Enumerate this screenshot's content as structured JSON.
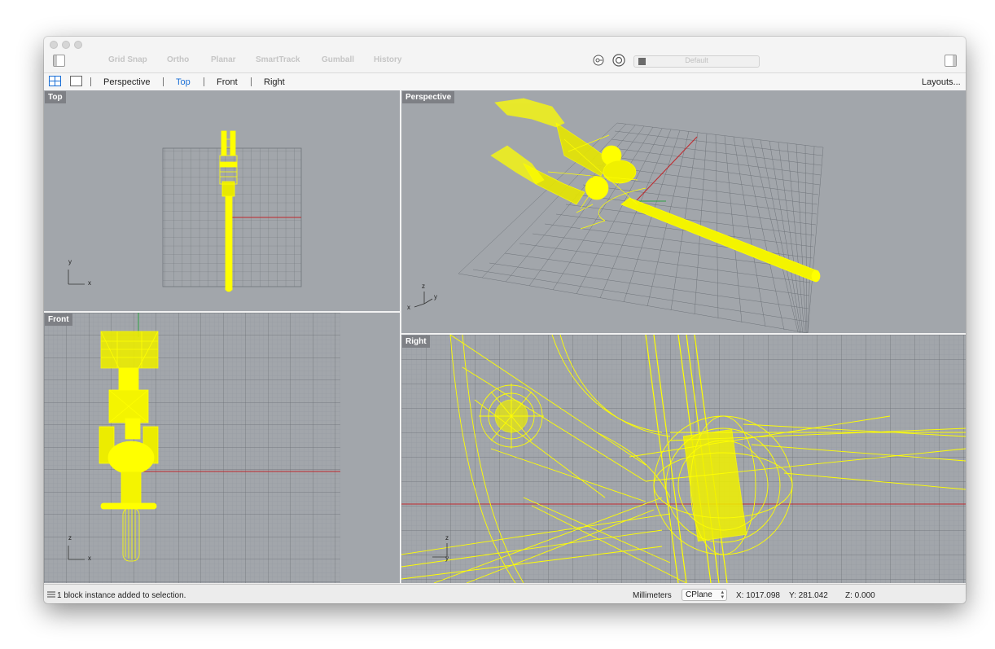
{
  "toolbar": {
    "buttons": [
      "Grid Snap",
      "Ortho",
      "Planar",
      "SmartTrack",
      "Gumball",
      "History"
    ],
    "layer_name": "Default"
  },
  "tabs": {
    "items": [
      "Perspective",
      "Top",
      "Front",
      "Right"
    ],
    "active": "Top",
    "layouts_label": "Layouts..."
  },
  "viewports": {
    "top": "Top",
    "perspective": "Perspective",
    "front": "Front",
    "right": "Right"
  },
  "axes": {
    "x": "x",
    "y": "y",
    "z": "z"
  },
  "status": {
    "message": "1 block instance added to selection.",
    "units": "Millimeters",
    "cplane": "CPlane",
    "x": "X: 1017.098",
    "y": "Y: 281.042",
    "z": "Z: 0.000"
  },
  "colors": {
    "viewport_bg": "#a2a6ab",
    "wireframe": "#ffff00",
    "x_axis": "#c0282c",
    "y_axis": "#2ea043",
    "active_tab": "#1a6fd6"
  }
}
